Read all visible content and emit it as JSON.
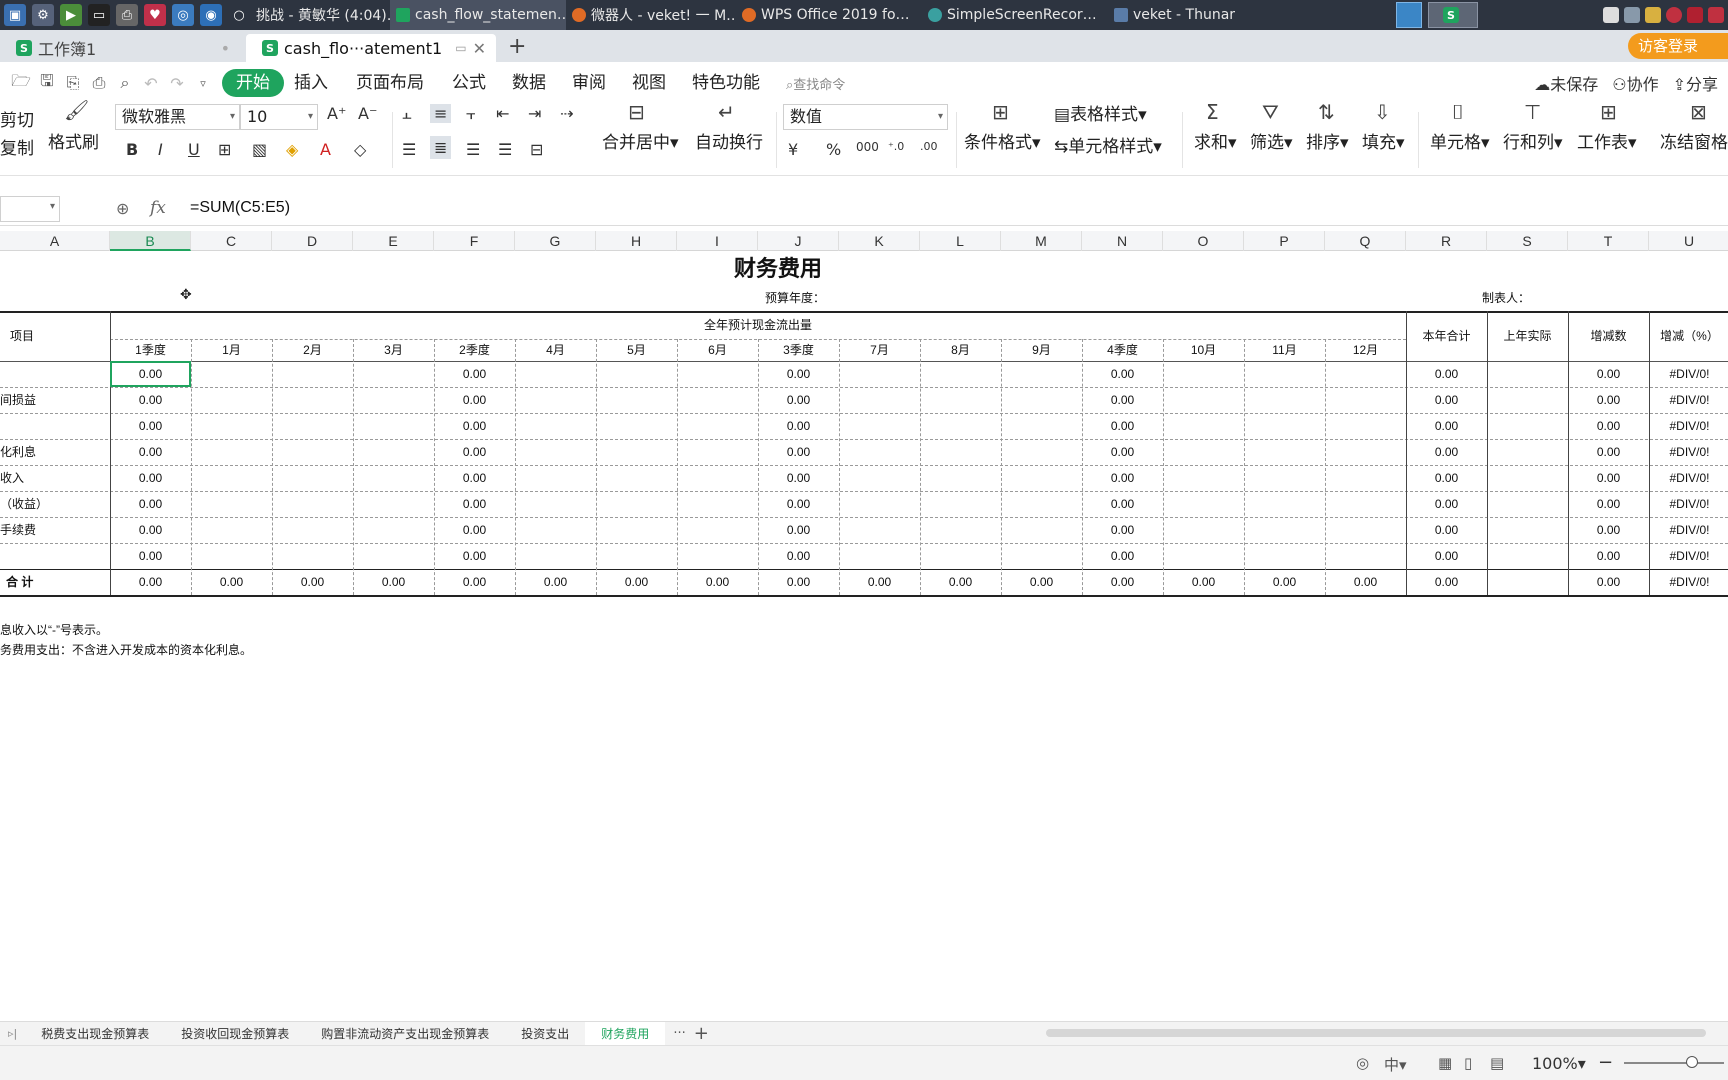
{
  "taskbar": {
    "windows": [
      {
        "label": "挑战 - 黄敏华 (4:04)…",
        "active": false
      },
      {
        "label": "cash_flow_statemen…",
        "active": true
      },
      {
        "label": "微器人 - veket! 一 M…",
        "active": false
      },
      {
        "label": "WPS Office 2019 fo…",
        "active": false
      },
      {
        "label": "SimpleScreenRecor…",
        "active": false
      },
      {
        "label": "veket - Thunar",
        "active": false
      }
    ]
  },
  "doc_tabs": {
    "tabs": [
      {
        "label": "工作簿1",
        "active": false
      },
      {
        "label": "cash_flo···atement1",
        "active": true
      }
    ],
    "visitor_login": "访客登录"
  },
  "menu": {
    "items": [
      "开始",
      "插入",
      "页面布局",
      "公式",
      "数据",
      "审阅",
      "视图",
      "特色功能"
    ],
    "search_placeholder": "查找命令",
    "unsaved": "未保存",
    "collaborate": "协作",
    "share": "分享"
  },
  "ribbon": {
    "cut": "剪切",
    "copy": "复制",
    "format_painter": "格式刷",
    "font_name": "微软雅黑",
    "font_size": "10",
    "merge_center": "合并居中",
    "auto_wrap": "自动换行",
    "number_format": "数值",
    "conditional_format": "条件格式",
    "table_style": "表格样式",
    "cell_style": "单元格样式",
    "sum": "求和",
    "filter": "筛选",
    "sort": "排序",
    "fill": "填充",
    "cell": "单元格",
    "row_col": "行和列",
    "worksheet": "工作表",
    "freeze": "冻结窗格"
  },
  "formula_bar": {
    "fx": "fx",
    "formula": "=SUM(C5:E5)"
  },
  "columns": [
    "A",
    "B",
    "C",
    "D",
    "E",
    "F",
    "G",
    "H",
    "I",
    "J",
    "K",
    "L",
    "M",
    "N",
    "O",
    "P",
    "Q",
    "R",
    "S",
    "T",
    "U"
  ],
  "selected_column": "B",
  "sheet": {
    "title": "财务费用",
    "budget_year_label": "预算年度：",
    "preparer_label": "制表人：",
    "item_header": "项目",
    "group_header": "全年预计现金流出量",
    "period_headers": [
      "1季度",
      "1月",
      "2月",
      "3月",
      "2季度",
      "4月",
      "5月",
      "6月",
      "3季度",
      "7月",
      "8月",
      "9月",
      "4季度",
      "10月",
      "11月",
      "12月"
    ],
    "annual_total": "本年合计",
    "last_year_actual": "上年实际",
    "change_amount": "增减数",
    "change_pct": "增减（%）",
    "row_labels": [
      "",
      "间损益",
      "",
      "化利息",
      "收入",
      "（收益）",
      "手续费",
      ""
    ],
    "total_label": "合 计",
    "zero": "0.00",
    "div0": "#DIV/0!",
    "notes": [
      "息收入以“-”号表示。",
      "务费用支出：不含进入开发成本的资本化利息。"
    ]
  },
  "sheet_tabs": {
    "tabs": [
      "税费支出现金预算表",
      "投资收回现金预算表",
      "购置非流动资产支出现金预算表",
      "投资支出",
      "财务费用"
    ],
    "active": "财务费用"
  },
  "status": {
    "zoom": "100%"
  }
}
